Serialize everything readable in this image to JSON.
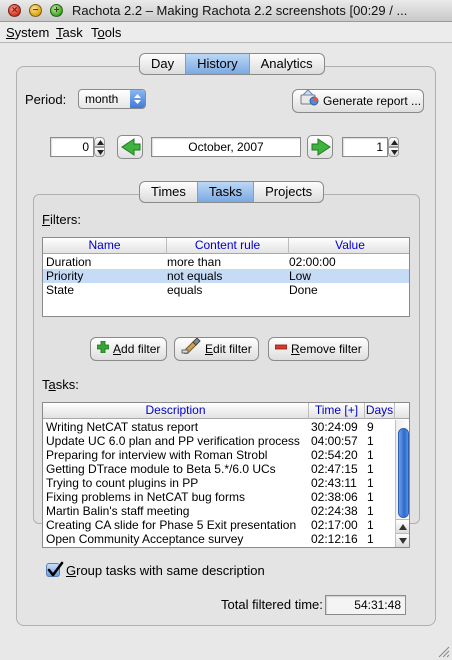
{
  "window": {
    "title": "Rachota 2.2 – Making Rachota 2.2 screenshots [00:29 / ..."
  },
  "menu": {
    "items": [
      {
        "label": "System",
        "mnemonic": "S",
        "rest": "ystem"
      },
      {
        "label": "Task",
        "mnemonic": "T",
        "rest": "ask"
      },
      {
        "label": "Tools",
        "mnemonic": "o",
        "pre": "T",
        "rest": "ols"
      }
    ]
  },
  "main_tabs": [
    "Day",
    "History",
    "Analytics"
  ],
  "main_tabs_active": "History",
  "period": {
    "label": "Period:",
    "selected": "month"
  },
  "generate_report": {
    "label": "Generate report ..."
  },
  "navigator": {
    "left_value": "0",
    "date": "October, 2007",
    "right_value": "1"
  },
  "sub_tabs": [
    "Times",
    "Tasks",
    "Projects"
  ],
  "sub_tabs_active": "Tasks",
  "filters": {
    "label": "Filters:",
    "columns": [
      "Name",
      "Content rule",
      "Value"
    ],
    "rows": [
      {
        "name": "Duration",
        "rule": "more than",
        "value": "02:00:00",
        "selected": false
      },
      {
        "name": "Priority",
        "rule": "not equals",
        "value": "Low",
        "selected": true
      },
      {
        "name": "State",
        "rule": "equals",
        "value": "Done",
        "selected": false
      }
    ]
  },
  "filter_buttons": {
    "add": {
      "mnemonic": "A",
      "rest": "dd filter"
    },
    "edit": {
      "mnemonic": "E",
      "rest": "dit filter"
    },
    "remove": {
      "mnemonic": "R",
      "rest": "emove filter"
    }
  },
  "tasks": {
    "label": "Tasks:",
    "columns": [
      "Description",
      "Time [+]",
      "Days"
    ],
    "rows": [
      {
        "description": "Writing NetCAT status report",
        "time": "30:24:09",
        "days": "9"
      },
      {
        "description": "Update UC 6.0 plan and PP verification process",
        "time": "04:00:57",
        "days": "1"
      },
      {
        "description": "Preparing for interview with Roman Strobl",
        "time": "02:54:20",
        "days": "1"
      },
      {
        "description": "Getting DTrace module to Beta 5.*/6.0 UCs",
        "time": "02:47:15",
        "days": "1"
      },
      {
        "description": "Trying to count plugins in PP",
        "time": "02:43:11",
        "days": "1"
      },
      {
        "description": "Fixing problems in NetCAT bug forms",
        "time": "02:38:06",
        "days": "1"
      },
      {
        "description": "Martin Balin's staff meeting",
        "time": "02:24:38",
        "days": "1"
      },
      {
        "description": "Creating CA slide for Phase 5 Exit presentation",
        "time": "02:17:00",
        "days": "1"
      },
      {
        "description": "Open Community Acceptance survey",
        "time": "02:12:16",
        "days": "1"
      }
    ]
  },
  "group_tasks": {
    "checked": true,
    "mnemonic": "G",
    "rest": "roup tasks with same description"
  },
  "total": {
    "label": "Total filtered time:",
    "value": "54:31:48"
  },
  "colors": {
    "accent": "#3f7bd6",
    "selection": "#c6dbf5",
    "header_text": "#0000cc"
  },
  "icons": [
    "close-icon",
    "minimize-icon",
    "zoom-icon",
    "chevron-updown-icon",
    "report-icon",
    "arrow-left-icon",
    "arrow-right-icon",
    "plus-icon",
    "edit-icon",
    "minus-icon",
    "checkmark-icon"
  ]
}
